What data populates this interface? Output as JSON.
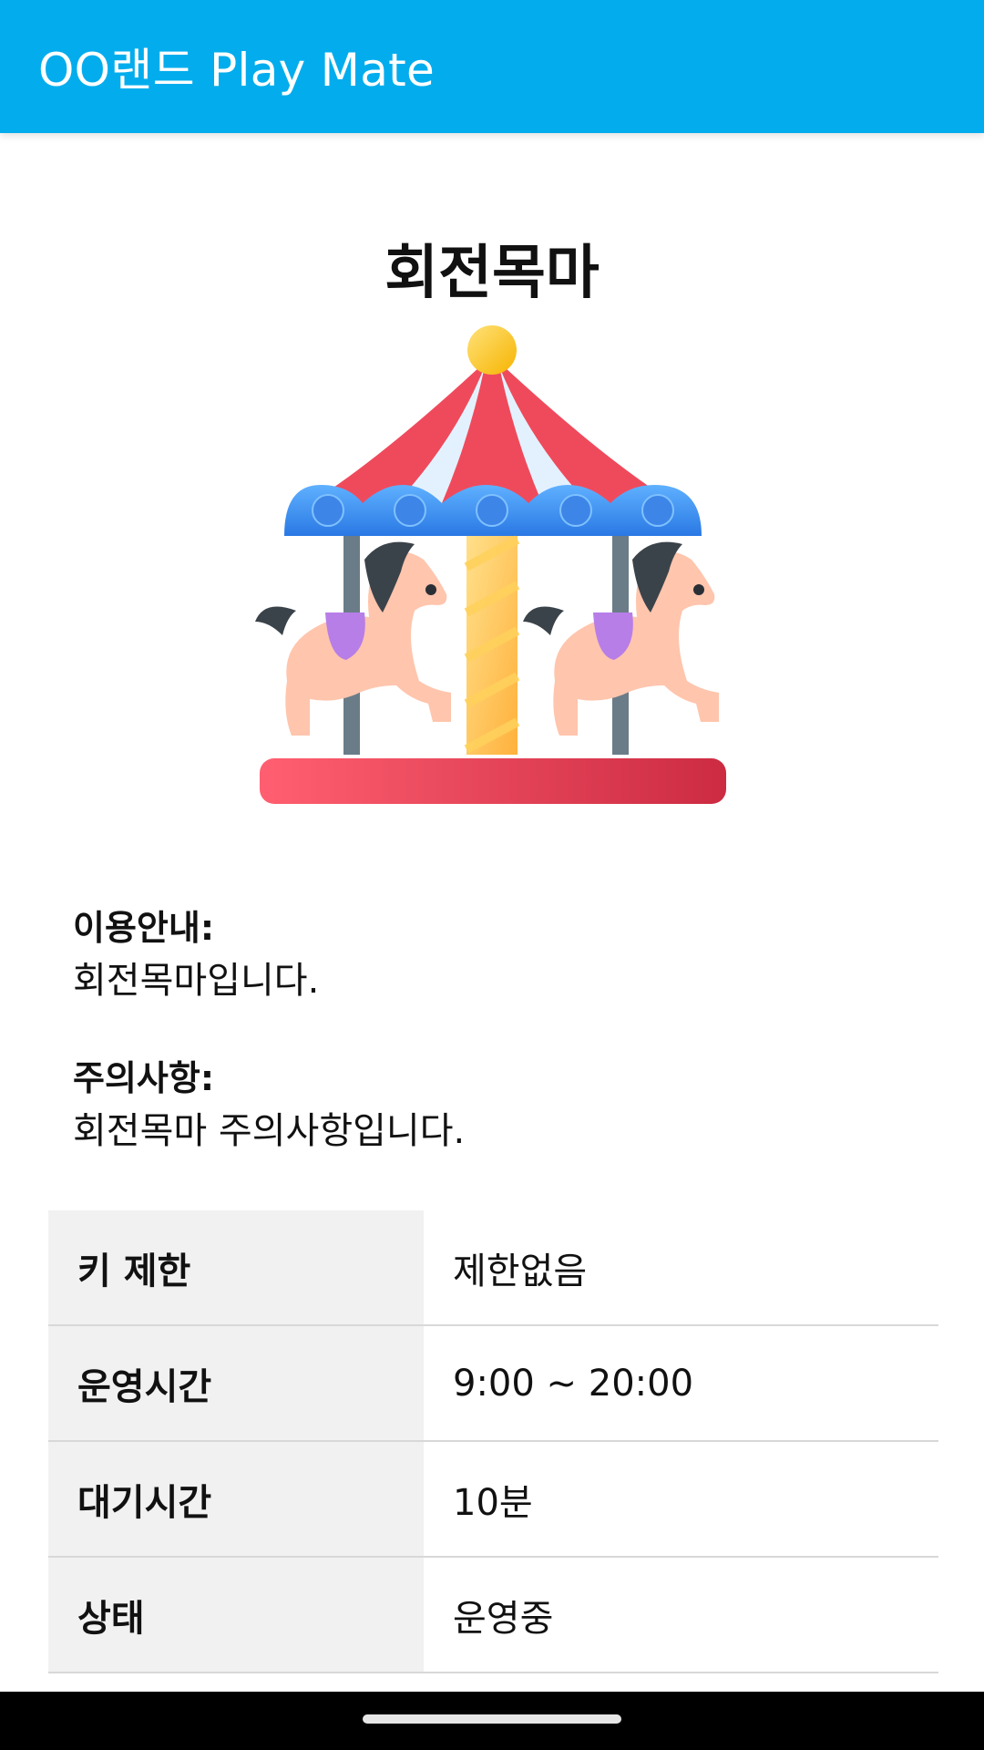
{
  "app_bar": {
    "title": "OO랜드 Play Mate"
  },
  "ride": {
    "name": "회전목마",
    "image_icon": "carousel-illustration"
  },
  "guide": {
    "label": "이용안내:",
    "text": "회전목마입니다."
  },
  "caution": {
    "label": "주의사항:",
    "text": "회전목마 주의사항입니다."
  },
  "details": [
    {
      "label": "키 제한",
      "value": "제한없음"
    },
    {
      "label": "운영시간",
      "value": "9:00 ~ 20:00"
    },
    {
      "label": "대기시간",
      "value": "10분"
    },
    {
      "label": "상태",
      "value": "운영중"
    }
  ],
  "colors": {
    "app_bar": "#03aded",
    "roof_red": "#ef4a5c",
    "canopy_blue": "#3f90ef",
    "base_red": "#ea4a5c"
  }
}
